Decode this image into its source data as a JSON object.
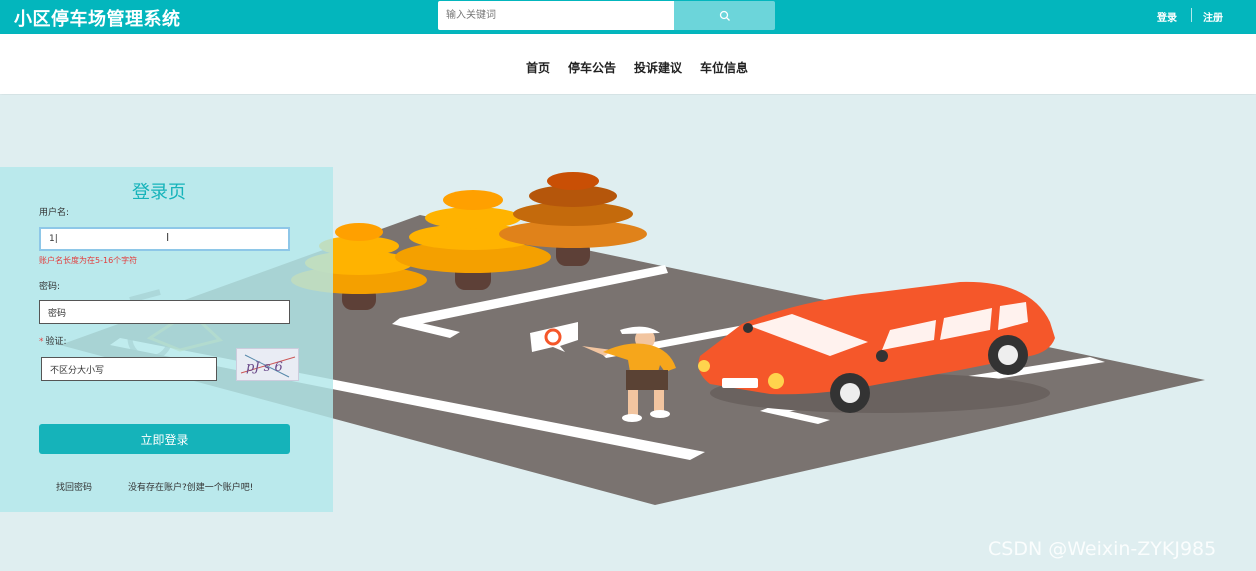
{
  "header": {
    "logo": "小区停车场管理系统",
    "search_placeholder": "输入关键词",
    "search_icon": "search-icon",
    "login": "登录",
    "register": "注册"
  },
  "nav": [
    "首页",
    "停车公告",
    "投诉建议",
    "车位信息"
  ],
  "login_form": {
    "title": "登录页",
    "username_label": "用户名:",
    "username_value": "1|",
    "username_error": "账户名长度为在5-16个字符",
    "password_label": "密码:",
    "password_placeholder": "密码",
    "captcha_label": "验证:",
    "captcha_placeholder": "不区分大小写",
    "captcha_text": "pJ s 6",
    "submit": "立即登录",
    "forgot": "找回密码",
    "register_prompt": "没有存在账户?创建一个账户吧!"
  },
  "watermark": "CSDN @Weixin-ZYKJ985",
  "colors": {
    "primary": "#03b6bd",
    "accent_button": "#15b3ba",
    "car": "#f5572a",
    "error": "#e33b3b"
  }
}
